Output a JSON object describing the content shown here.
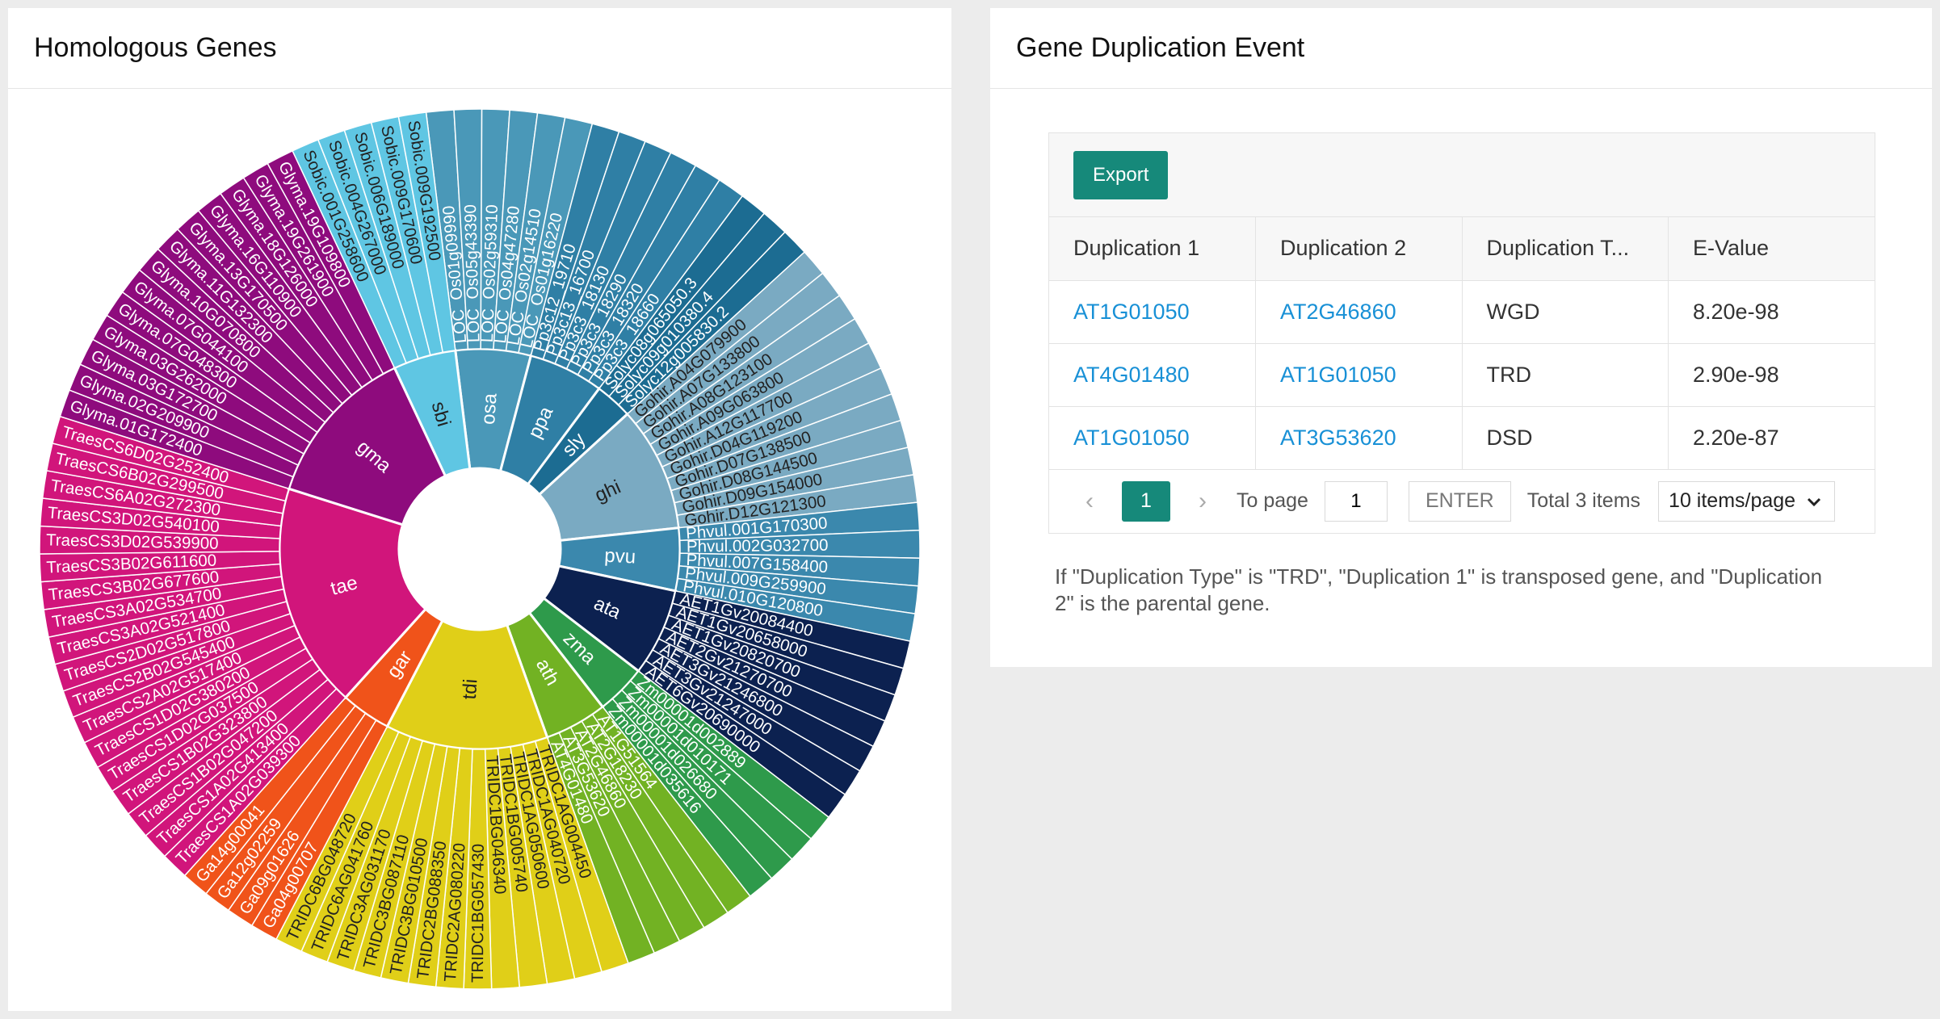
{
  "left_panel": {
    "title": "Homologous Genes"
  },
  "right_panel": {
    "title": "Gene Duplication Event",
    "export_label": "Export",
    "columns": [
      "Duplication 1",
      "Duplication 2",
      "Duplication T...",
      "E-Value"
    ],
    "rows": [
      {
        "dup1": "AT1G01050",
        "dup2": "AT2G46860",
        "type": "WGD",
        "evalue": "8.20e-98"
      },
      {
        "dup1": "AT4G01480",
        "dup2": "AT1G01050",
        "type": "TRD",
        "evalue": "2.90e-98"
      },
      {
        "dup1": "AT1G01050",
        "dup2": "AT3G53620",
        "type": "DSD",
        "evalue": "2.20e-87"
      }
    ],
    "pagination": {
      "prev_icon": "chevron-left-icon",
      "next_icon": "chevron-right-icon",
      "current_page": "1",
      "to_page_label": "To page",
      "to_page_value": "1",
      "enter_label": "ENTER",
      "total_label": "Total 3 items",
      "page_size": "10 items/page"
    },
    "note": "If \"Duplication Type\" is \"TRD\", \"Duplication 1\" is transposed gene, and \"Duplication 2\" is the parental gene."
  },
  "sunburst": {
    "start_angle_deg": -7,
    "groups": [
      {
        "name": "osa",
        "color": "#4a98b8",
        "genes": [
          "LOC_Os01g09990",
          "LOC_Os05g43390",
          "LOC_Os02g59310",
          "LOC_Os04g47280",
          "LOC_Os02g14510",
          "LOC_Os01g16220"
        ]
      },
      {
        "name": "ppa",
        "color": "#2f7fa5",
        "genes": [
          "Pp3c12_19710",
          "Pp3c13_16700",
          "Pp3c3_18130",
          "Pp3c3_18290",
          "Pp3c3_18320",
          "Pp3c3_18660"
        ]
      },
      {
        "name": "sly",
        "color": "#1c6c92",
        "genes": [
          "Solyc08g065050.3",
          "Solyc09g010380.4",
          "Solyc12g005830.2"
        ]
      },
      {
        "name": "ghi",
        "color": "#7aaac2",
        "genes": [
          "Gohir.A04G079900",
          "Gohir.A07G133800",
          "Gohir.A08G123100",
          "Gohir.A09G063800",
          "Gohir.A12G117700",
          "Gohir.D04G119200",
          "Gohir.D07G138500",
          "Gohir.D08G144500",
          "Gohir.D09G154000",
          "Gohir.D12G121300"
        ]
      },
      {
        "name": "pvu",
        "color": "#3b88ad",
        "genes": [
          "Phvul.001G170300",
          "Phvul.002G032700",
          "Phvul.007G158400",
          "Phvul.009G259900",
          "Phvul.010G120800"
        ]
      },
      {
        "name": "ata",
        "color": "#0c2150",
        "genes": [
          "AET1Gv20084400",
          "AET1Gv20658000",
          "AET1Gv20820700",
          "AET2Gv21270700",
          "AET3Gv21246800",
          "AET3Gv21247000",
          "AET6Gv20690000"
        ]
      },
      {
        "name": "zma",
        "color": "#2e9a4b",
        "genes": [
          "Zm00001d002889",
          "Zm00001d010171",
          "Zm00001d026680",
          "Zm00001d035616"
        ]
      },
      {
        "name": "ath",
        "color": "#72b223",
        "genes": [
          "AT1G51564",
          "AT2G18230",
          "AT2G46860",
          "AT3G53620",
          "AT4G01480"
        ]
      },
      {
        "name": "tdi",
        "color": "#e0cf18",
        "genes": [
          "TRIDC1AG004450",
          "TRIDC1AG040720",
          "TRIDC1AG050600",
          "TRIDC1BG005740",
          "TRIDC1BG046340",
          "TRIDC1BG057430",
          "TRIDC2AG080220",
          "TRIDC2BG088350",
          "TRIDC3BG010500",
          "TRIDC3BG087110",
          "TRIDC3AG031170",
          "TRIDC6AG041760",
          "TRIDC6BG048720"
        ]
      },
      {
        "name": "gar",
        "color": "#f0531a",
        "genes": [
          "Ga04g00707",
          "Ga09g01626",
          "Ga12g02259",
          "Ga14g00041"
        ]
      },
      {
        "name": "tae",
        "color": "#d1157b",
        "genes": [
          "TraesCS1A02G039300",
          "TraesCS1A02G413400",
          "TraesCS1B02G047200",
          "TraesCS1B02G323800",
          "TraesCS1D02G037500",
          "TraesCS1D02G380200",
          "TraesCS2A02G517400",
          "TraesCS2B02G545400",
          "TraesCS2D02G517800",
          "TraesCS3A02G521400",
          "TraesCS3A02G534700",
          "TraesCS3B02G677600",
          "TraesCS3B02G611600",
          "TraesCS3D02G539900",
          "TraesCS3D02G540100",
          "TraesCS6A02G272300",
          "TraesCS6B02G299500",
          "TraesCS6D02G252400"
        ]
      },
      {
        "name": "gma",
        "color": "#8e0b7d",
        "genes": [
          "Glyma.01G172400",
          "Glyma.02G209900",
          "Glyma.03G172700",
          "Glyma.03G262000",
          "Glyma.07G048300",
          "Glyma.07G044100",
          "Glyma.10G070800",
          "Glyma.11G132300",
          "Glyma.13G170500",
          "Glyma.16G110900",
          "Glyma.18G126000",
          "Glyma.19G261900",
          "Glyma.19G109800"
        ]
      },
      {
        "name": "sbi",
        "color": "#5fc6e3",
        "genes": [
          "Sobic.001G258600",
          "Sobic.004G267000",
          "Sobic.006G189000",
          "Sobic.009G170600",
          "Sobic.009G192500"
        ]
      }
    ]
  }
}
